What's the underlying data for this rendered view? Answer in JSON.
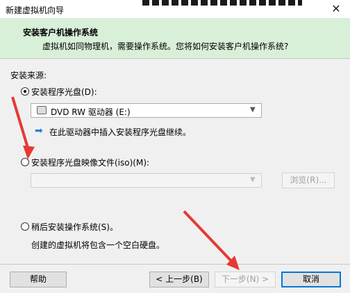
{
  "window": {
    "title": "新建虚拟机向导"
  },
  "header": {
    "title": "安装客户机操作系统",
    "subtitle": "虚拟机如同物理机，需要操作系统。您将如何安装客户机操作系统?"
  },
  "install_source": {
    "label": "安装来源:",
    "option_disc": {
      "label": "安装程序光盘(D):",
      "selected": true
    },
    "drive_select": {
      "value": "DVD RW 驱动器 (E:)"
    },
    "info_message": "在此驱动器中插入安装程序光盘继续。",
    "option_iso": {
      "label": "安装程序光盘映像文件(iso)(M):",
      "selected": false
    },
    "iso_path": {
      "value": ""
    },
    "browse_label": "浏览(R)...",
    "option_later": {
      "label": "稍后安装操作系统(S)。",
      "selected": false
    },
    "later_desc": "创建的虚拟机将包含一个空白硬盘。"
  },
  "footer": {
    "help_label": "帮助",
    "back_label": "< 上一步(B)",
    "next_label": "下一步(N) >",
    "cancel_label": "取消"
  },
  "colors": {
    "header_bg": "#d8efd8",
    "accent": "#0078d7",
    "annotation_arrow": "#e53935"
  },
  "icons": [
    "close-icon",
    "disc-drive-icon",
    "chevron-down-icon",
    "info-arrow-icon"
  ]
}
